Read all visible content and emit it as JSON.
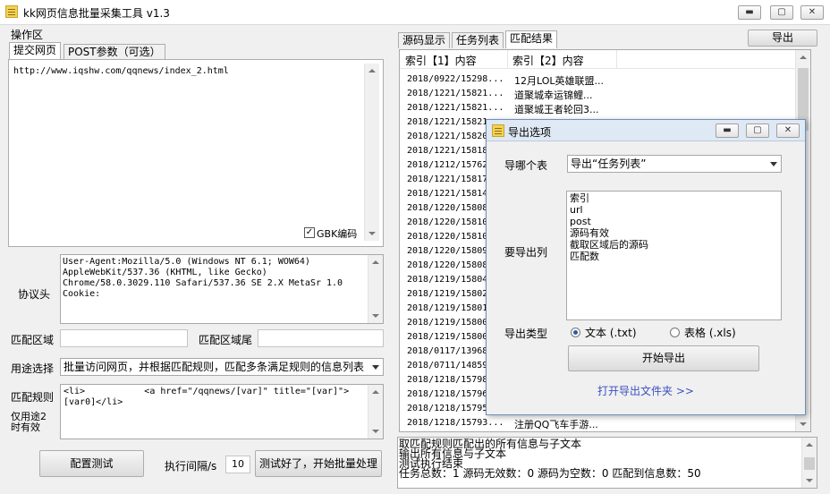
{
  "window": {
    "title": "kk网页信息批量采集工具 v1.3",
    "minimize": "▬",
    "maximize": "▢",
    "close": "✕"
  },
  "left": {
    "group_label": "操作区",
    "tabs": [
      "提交网页",
      "POST参数（可选）"
    ],
    "url_text": "http://www.iqshw.com/qqnews/index_2.html",
    "gbk_label": "GBK编码",
    "gbk_checked": "✓",
    "header_label": "协议头",
    "header_text": "User-Agent:Mozilla/5.0 (Windows NT 6.1; WOW64)\nAppleWebKit/537.36 (KHTML, like Gecko)\nChrome/58.0.3029.110 Safari/537.36 SE 2.X MetaSr 1.0\nCookie:",
    "region_label": "匹配区域",
    "region_end_label": "匹配区域尾",
    "purpose_label": "用途选择",
    "purpose_value": "批量访问网页，并根据匹配规则，匹配多条满足规则的信息列表",
    "rule_label": "匹配规则",
    "rule_note": "仅用途2\n时有效",
    "rule_text": "<li>           <a href=\"/qqnews/[var]\" title=\"[var]\">\n[var0]</li>",
    "config_test_btn": "配置测试",
    "interval_label": "执行间隔/s",
    "interval_value": "10",
    "start_batch_btn": "测试好了，开始批量处理"
  },
  "right": {
    "tabs": [
      "源码显示",
      "任务列表",
      "匹配结果"
    ],
    "export_btn": "导出",
    "columns": [
      "索引【1】内容",
      "索引【2】内容"
    ],
    "rows": [
      [
        "2018/0922/15298...",
        "12月LOL英雄联盟..."
      ],
      [
        "2018/1221/15821...",
        "道聚城幸运锦鲤..."
      ],
      [
        "2018/1221/15821...",
        "道聚城王者轮回3..."
      ],
      [
        "2018/1221/15821",
        ""
      ],
      [
        "2018/1221/15820",
        ""
      ],
      [
        "2018/1221/15818",
        ""
      ],
      [
        "2018/1212/15762",
        ""
      ],
      [
        "2018/1221/15817",
        ""
      ],
      [
        "2018/1221/15814",
        ""
      ],
      [
        "2018/1220/15808",
        ""
      ],
      [
        "2018/1220/15810",
        ""
      ],
      [
        "2018/1220/15810",
        ""
      ],
      [
        "2018/1220/15809",
        ""
      ],
      [
        "2018/1220/15808",
        ""
      ],
      [
        "2018/1219/15804",
        ""
      ],
      [
        "2018/1219/15802",
        ""
      ],
      [
        "2018/1219/15801",
        ""
      ],
      [
        "2018/1219/15800",
        ""
      ],
      [
        "2018/1219/15800",
        ""
      ],
      [
        "2018/0117/13968",
        ""
      ],
      [
        "2018/0711/14859",
        ""
      ],
      [
        "2018/1218/15798",
        ""
      ],
      [
        "2018/1218/15796",
        ""
      ],
      [
        "2018/1218/15795",
        ""
      ],
      [
        "2018/1218/15793...",
        "注册QQ飞车手游..."
      ]
    ],
    "log": [
      "取匹配规则匹配出的所有信息与子文本",
      "输出所有信息与子文本",
      "测试执行结束",
      "任务总数：1 源码无效数：0 源码为空数：0 匹配到信息数：50"
    ]
  },
  "dialog": {
    "title": "导出选项",
    "which_table_label": "导哪个表",
    "which_table_value": "导出“任务列表”",
    "columns_label": "要导出列",
    "columns": [
      "索引",
      "url",
      "post",
      "源码有效",
      "截取区域后的源码",
      "匹配数"
    ],
    "type_label": "导出类型",
    "type_text": "文本 (.txt)",
    "type_xls": "表格 (.xls)",
    "start_btn": "开始导出",
    "open_folder_link": "打开导出文件夹 >>",
    "link_color": "#3b4fbf"
  }
}
